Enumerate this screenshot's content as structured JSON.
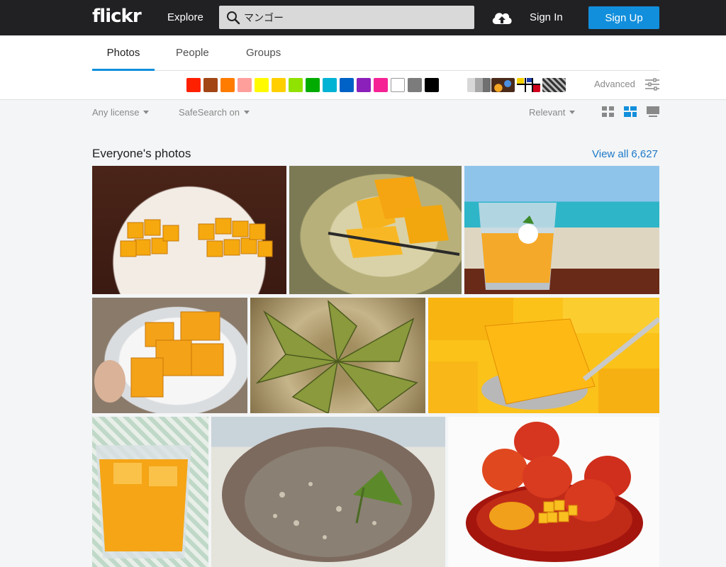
{
  "header": {
    "logo": "flickr",
    "explore": "Explore",
    "search_value": "マンゴー",
    "sign_in": "Sign In",
    "sign_up": "Sign Up"
  },
  "tabs": [
    {
      "label": "Photos",
      "active": true
    },
    {
      "label": "People",
      "active": false
    },
    {
      "label": "Groups",
      "active": false
    }
  ],
  "colors": [
    "#ff2000",
    "#a24615",
    "#ff7c00",
    "#ff9f9c",
    "#fffa00",
    "#ffcf00",
    "#90e200",
    "#00ab00",
    "#00b2d4",
    "#0062c6",
    "#8c20ba",
    "#f52394",
    "#ffffff",
    "#7c7c7c",
    "#000000"
  ],
  "advanced": "Advanced",
  "filters": {
    "license": "Any license",
    "safesearch": "SafeSearch on",
    "sort": "Relevant"
  },
  "section": {
    "title": "Everyone's photos",
    "view_all": "View all",
    "count": "6,627"
  },
  "accent": "#128fdc"
}
